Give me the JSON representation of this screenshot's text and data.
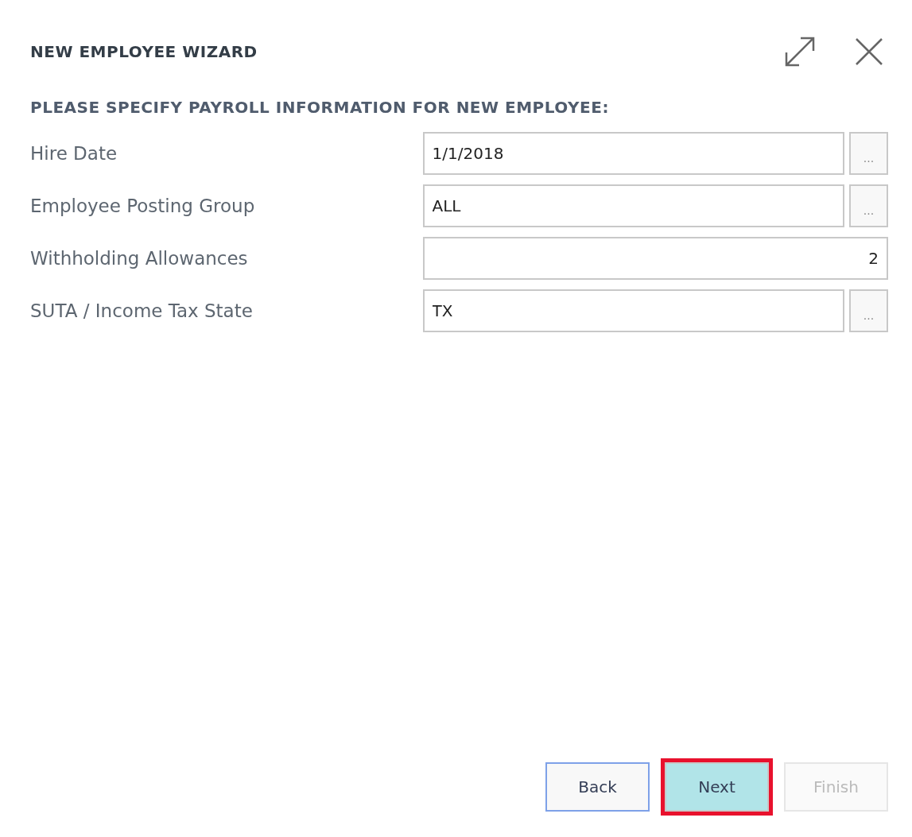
{
  "window": {
    "title": "NEW EMPLOYEE WIZARD"
  },
  "heading": "PLEASE SPECIFY PAYROLL INFORMATION FOR NEW EMPLOYEE:",
  "fields": [
    {
      "label": "Hire Date",
      "value": "1/1/2018",
      "kind": "lookup",
      "lookup_button": "..."
    },
    {
      "label": "Employee Posting Group",
      "value": "ALL",
      "kind": "lookup",
      "lookup_button": "..."
    },
    {
      "label": "Withholding Allowances",
      "value": "2",
      "kind": "number"
    },
    {
      "label": "SUTA / Income Tax State",
      "value": "TX",
      "kind": "lookup",
      "lookup_button": "..."
    }
  ],
  "buttons": [
    {
      "label": "Back",
      "focused": true,
      "highlighted": false,
      "disabled": false
    },
    {
      "label": "Next",
      "focused": false,
      "highlighted": true,
      "disabled": false
    },
    {
      "label": "Finish",
      "focused": false,
      "highlighted": false,
      "disabled": true
    }
  ]
}
